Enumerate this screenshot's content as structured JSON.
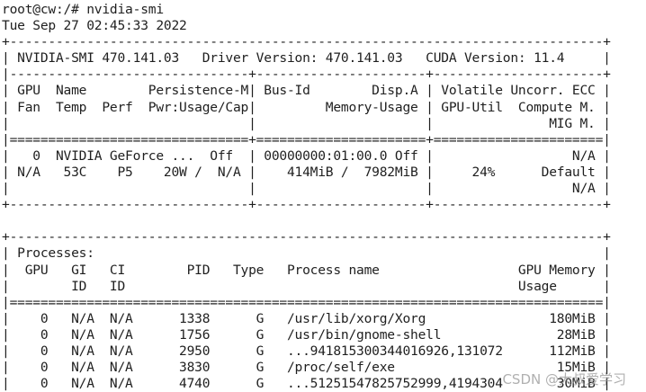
{
  "terminal": {
    "lines": [
      "root@cw:/# nvidia-smi",
      "Tue Sep 27 02:45:33 2022",
      "+-----------------------------------------------------------------------------+",
      "| NVIDIA-SMI 470.141.03   Driver Version: 470.141.03   CUDA Version: 11.4     |",
      "|-------------------------------+----------------------+----------------------+",
      "| GPU  Name        Persistence-M| Bus-Id        Disp.A | Volatile Uncorr. ECC |",
      "| Fan  Temp  Perf  Pwr:Usage/Cap|         Memory-Usage | GPU-Util  Compute M. |",
      "|                               |                      |               MIG M. |",
      "|===============================+======================+======================|",
      "|   0  NVIDIA GeForce ...  Off  | 00000000:01:00.0 Off |                  N/A |",
      "| N/A   53C    P5    20W /  N/A |    414MiB /  7982MiB |     24%      Default |",
      "|                               |                      |                  N/A |",
      "+-------------------------------+----------------------+----------------------+",
      "",
      "+-----------------------------------------------------------------------------+",
      "| Processes:                                                                  |",
      "|  GPU   GI   CI        PID   Type   Process name                  GPU Memory |",
      "|        ID   ID                                                   Usage      |",
      "|=============================================================================|",
      "|    0   N/A  N/A      1338      G   /usr/lib/xorg/Xorg                180MiB |",
      "|    0   N/A  N/A      1756      G   /usr/bin/gnome-shell               28MiB |",
      "|    0   N/A  N/A      2950      G   ...941815300344016926,131072      112MiB |",
      "|    0   N/A  N/A      3830      G   /proc/self/exe                     15MiB |",
      "|    0   N/A  N/A      4740      G   ...51251547825752999,4194304       30MiB |"
    ]
  },
  "watermark": "CSDN @大叔爱学习"
}
